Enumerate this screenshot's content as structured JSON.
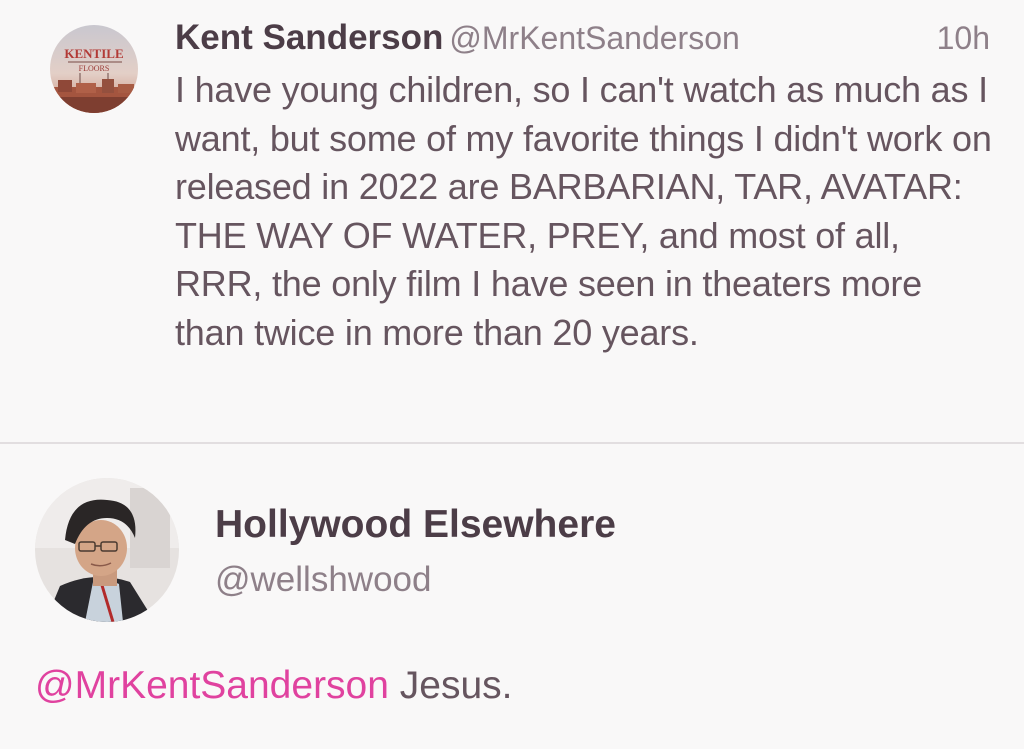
{
  "tweet": {
    "author_name": "Kent Sanderson",
    "author_handle": "@MrKentSanderson",
    "timestamp": "10h",
    "avatar_icon": "kentile-sign-avatar",
    "text": "I have young children, so I can't watch as much as I want, but some of my favorite things I didn't work on released in 2022 are BARBARIAN, TAR, AVATAR: THE WAY OF WATER, PREY, and most of all, RRR, the only film I have seen in theaters more than twice in more than 20 years."
  },
  "reply": {
    "author_name": "Hollywood Elsewhere",
    "author_handle": "@wellshwood",
    "avatar_icon": "profile-photo-avatar",
    "mention": "@MrKentSanderson",
    "text": " Jesus."
  },
  "colors": {
    "background": "#f9f8f8",
    "name_text": "#4c3d47",
    "body_text": "#66555f",
    "secondary_text": "#8e8089",
    "mention_accent": "#e0429f",
    "divider": "#e2dee0"
  }
}
